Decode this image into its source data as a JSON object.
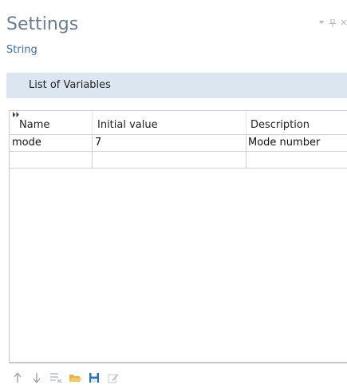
{
  "header": {
    "title": "Settings",
    "subtitle": "String",
    "controls": [
      "chevron-down-icon",
      "pin-icon",
      "close-icon"
    ]
  },
  "section": {
    "label": "List of Variables"
  },
  "table": {
    "columns": [
      "Name",
      "Initial value",
      "Description"
    ],
    "rows": [
      [
        "mode",
        "7",
        "Mode number"
      ],
      [
        "",
        "",
        ""
      ]
    ]
  },
  "toolbar": {
    "icons": [
      "move-up-icon",
      "move-down-icon",
      "clear-table-icon",
      "load-from-file-icon",
      "save-to-file-icon",
      "edit-icon"
    ]
  },
  "colors": {
    "title": "#6b7d94",
    "subtitle": "#3c6fa8",
    "section_bg": "#dce6f1"
  }
}
